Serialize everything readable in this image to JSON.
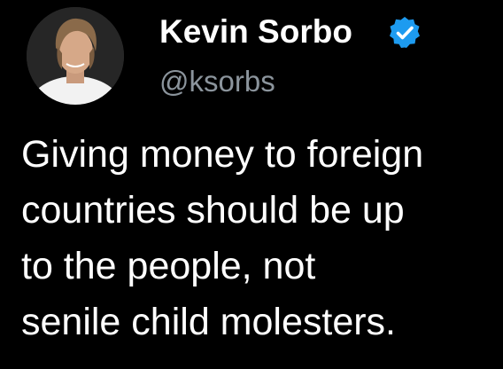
{
  "author": {
    "name": "Kevin Sorbo",
    "handle": "@ksorbs",
    "verified": true,
    "verified_color": "#1d9bf0",
    "avatar_icon": "profile-photo"
  },
  "tweet": {
    "lines": [
      "Giving money to foreign",
      "countries should be up",
      "to the people, not",
      "senile child molesters."
    ]
  },
  "colors": {
    "background": "#000000",
    "text": "#ffffff",
    "handle": "#8b949c"
  }
}
